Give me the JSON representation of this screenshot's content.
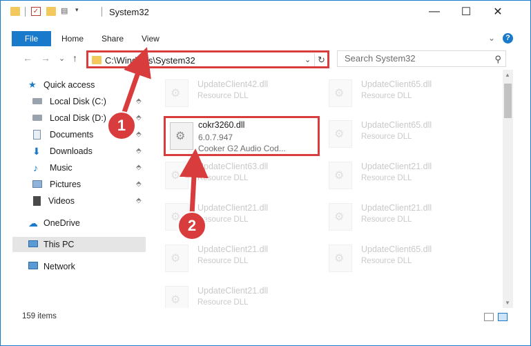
{
  "window": {
    "title": "System32",
    "controls": {
      "minimize": "—",
      "maximize": "☐",
      "close": "✕"
    }
  },
  "ribbon": {
    "tabs": [
      "File",
      "Home",
      "Share",
      "View"
    ],
    "expand_glyph": "⌄",
    "help_glyph": "?"
  },
  "nav": {
    "back": "←",
    "forward": "→",
    "recent": "⌄",
    "up": "↑",
    "address_path": "C:\\Windows\\System32",
    "address_dropdown": "⌄",
    "refresh_glyph": "↻",
    "search_placeholder": "Search System32",
    "search_glyph": "⚲"
  },
  "sidebar": {
    "items": [
      {
        "label": "Quick access",
        "icon": "star-icon",
        "pinned": false
      },
      {
        "label": "Local Disk (C:)",
        "icon": "drive-icon",
        "pinned": true
      },
      {
        "label": "Local Disk (D:)",
        "icon": "drive-icon",
        "pinned": true
      },
      {
        "label": "Documents",
        "icon": "documents-icon",
        "pinned": true
      },
      {
        "label": "Downloads",
        "icon": "downloads-icon",
        "pinned": true
      },
      {
        "label": "Music",
        "icon": "music-icon",
        "pinned": true
      },
      {
        "label": "Pictures",
        "icon": "pictures-icon",
        "pinned": true
      },
      {
        "label": "Videos",
        "icon": "videos-icon",
        "pinned": true
      },
      {
        "label": "OneDrive",
        "icon": "cloud-icon",
        "pinned": false
      },
      {
        "label": "This PC",
        "icon": "computer-icon",
        "pinned": false,
        "selected": true
      },
      {
        "label": "Network",
        "icon": "network-icon",
        "pinned": false
      }
    ],
    "pin_glyph": "📌"
  },
  "files": [
    {
      "name": "UpdateClient42.dll",
      "type": "Resource DLL"
    },
    {
      "name": "UpdateClient65.dll",
      "type": "Resource DLL"
    },
    {
      "name": "UpdateClient65.dll",
      "type": "Resource DLL"
    },
    {
      "name": "UpdateClient63.dll",
      "type": "Resource DLL"
    },
    {
      "name": "UpdateClient21.dll",
      "type": "Resource DLL"
    },
    {
      "name": "UpdateClient21.dll",
      "type": "Resource DLL"
    },
    {
      "name": "UpdateClient21.dll",
      "type": "Resource DLL"
    },
    {
      "name": "UpdateClient21.dll",
      "type": "Resource DLL"
    },
    {
      "name": "UpdateClient65.dll",
      "type": "Resource DLL"
    },
    {
      "name": "UpdateClient21.dll",
      "type": "Resource DLL"
    }
  ],
  "highlighted_file": {
    "name": "cokr3260.dll",
    "version": "6.0.7.947",
    "description": "Cooker G2 Audio Cod..."
  },
  "annotations": {
    "step1": "1",
    "step2": "2",
    "color": "#d93c3c"
  },
  "status": {
    "item_count": "159 items"
  },
  "colors": {
    "accent": "#1979ca",
    "highlight": "#d93c3c",
    "folder": "#f3c85c"
  }
}
